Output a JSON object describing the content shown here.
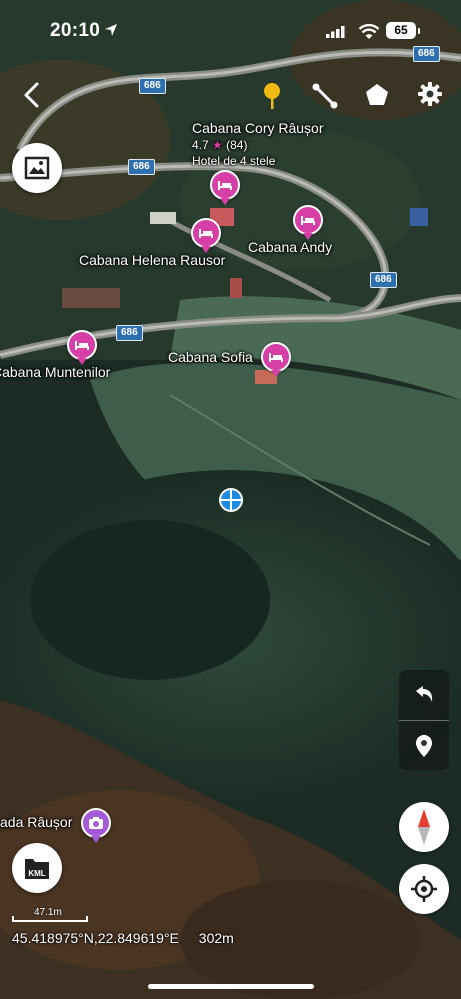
{
  "status_bar": {
    "time": "20:10",
    "battery": "65"
  },
  "toolbar": {
    "back_icon": "back-chevron-icon",
    "place_pin_icon": "yellow-pin-icon",
    "path_icon": "path-icon",
    "polygon_icon": "polygon-icon",
    "settings_icon": "gear-icon"
  },
  "roads": {
    "label": "686"
  },
  "pois": {
    "cory": {
      "name": "Cabana Cory Râușor",
      "rating": "4.7",
      "reviews": "(84)",
      "category": "Hotel de 4 stele"
    },
    "andy": "Cabana Andy",
    "helena": "Cabana Helena Rausor",
    "sofia": "Cabana Sofia",
    "muntenilor": "Cabana Muntenilor",
    "rausor": "Cascada Râușor",
    "rausor_visible": "ada Râușor"
  },
  "controls": {
    "image_overlay_icon": "image-icon",
    "undo_icon": "undo-icon",
    "location_pin_icon": "location-pin-icon",
    "compass_icon": "compass-icon",
    "kml_label": "KML",
    "locate_icon": "crosshair-icon"
  },
  "footer": {
    "scale": "47.1m",
    "coordinates": "45.418975°N,22.849619°E",
    "altitude": "302m"
  },
  "colors": {
    "poi_pin": "#d63fa5",
    "waterfall_pin": "#a35ad6",
    "road_badge": "#2e6fb0",
    "location_dot": "#1e8be0",
    "pin_yellow": "#f2b90f"
  }
}
